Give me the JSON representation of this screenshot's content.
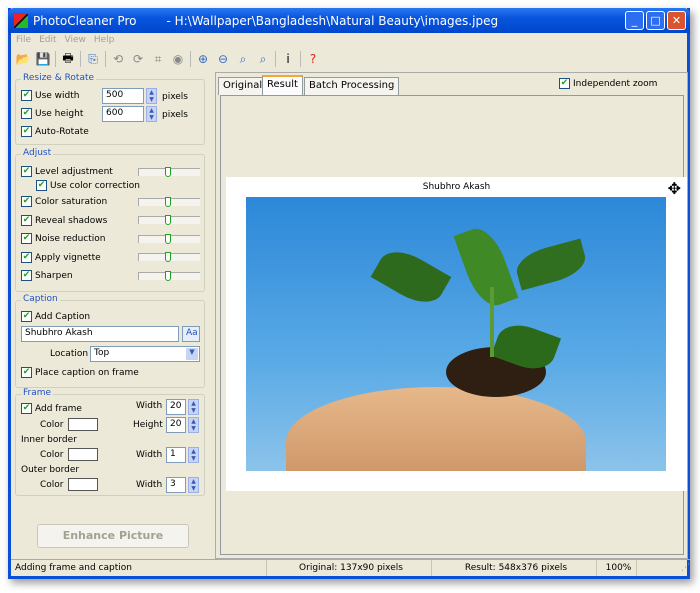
{
  "window": {
    "app": "PhotoCleaner Pro",
    "path": "- H:\\Wallpaper\\Bangladesh\\Natural Beauty\\images.jpeg"
  },
  "menu": [
    "File",
    "Edit",
    "View",
    "Help"
  ],
  "resize": {
    "label": "Resize & Rotate",
    "use_width": "Use width",
    "width": "500",
    "use_height": "Use height",
    "height": "600",
    "unit": "pixels",
    "auto_rotate": "Auto-Rotate"
  },
  "adjust": {
    "label": "Adjust",
    "items": [
      "Level adjustment",
      "Use color correction",
      "Color saturation",
      "Reveal shadows",
      "Noise reduction",
      "Apply vignette",
      "Sharpen"
    ]
  },
  "caption": {
    "label": "Caption",
    "add": "Add Caption",
    "text": "Shubhro Akash",
    "font_btn": "Aa",
    "location_label": "Location",
    "location": "Top",
    "place_on_frame": "Place caption on frame"
  },
  "frame": {
    "label": "Frame",
    "add": "Add frame",
    "width_label": "Width",
    "width": "20",
    "color_label": "Color",
    "height_label": "Height",
    "height": "20",
    "inner": "Inner border",
    "inner_width": "1",
    "outer": "Outer border",
    "outer_width": "3"
  },
  "enhance": "Enhance Picture",
  "tabs": [
    "Original",
    "Result",
    "Batch Processing"
  ],
  "independent_zoom": "Independent zoom",
  "preview_caption": "Shubhro Akash",
  "status": {
    "message": "Adding frame and caption",
    "original": "Original: 137x90 pixels",
    "result": "Result: 548x376 pixels",
    "zoom": "100%"
  }
}
